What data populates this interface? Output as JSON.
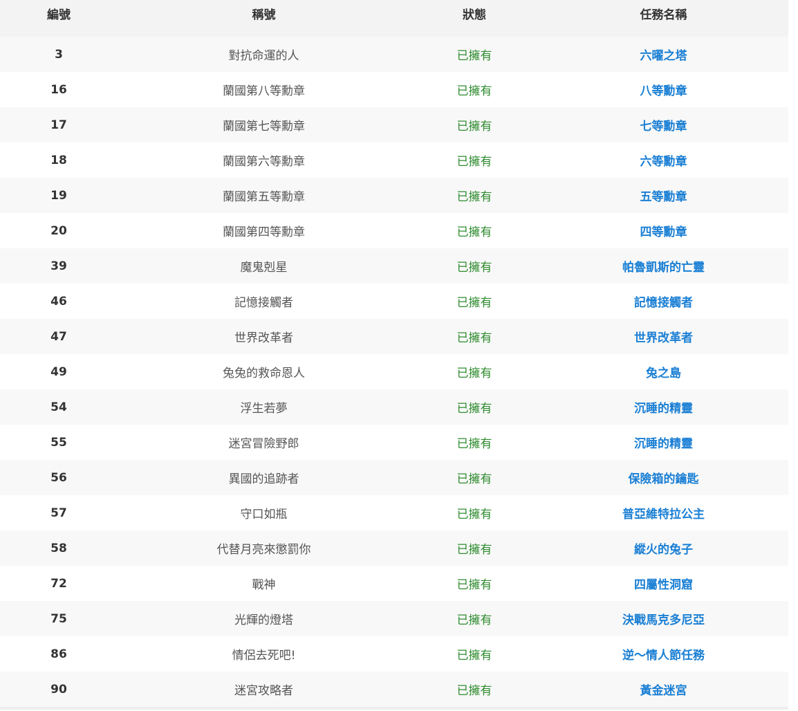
{
  "table": {
    "headers": {
      "id": "編號",
      "title": "稱號",
      "status": "狀態",
      "task": "任務名稱"
    },
    "rows": [
      {
        "id": "3",
        "title": "對抗命運的人",
        "status": "已擁有",
        "task": "六曜之塔"
      },
      {
        "id": "16",
        "title": "蘭國第八等勳章",
        "status": "已擁有",
        "task": "八等勳章"
      },
      {
        "id": "17",
        "title": "蘭國第七等勳章",
        "status": "已擁有",
        "task": "七等勳章"
      },
      {
        "id": "18",
        "title": "蘭國第六等勳章",
        "status": "已擁有",
        "task": "六等勳章"
      },
      {
        "id": "19",
        "title": "蘭國第五等勳章",
        "status": "已擁有",
        "task": "五等勳章"
      },
      {
        "id": "20",
        "title": "蘭國第四等勳章",
        "status": "已擁有",
        "task": "四等勳章"
      },
      {
        "id": "39",
        "title": "魔鬼剋星",
        "status": "已擁有",
        "task": "帕魯凱斯的亡靈"
      },
      {
        "id": "46",
        "title": "記憶接觸者",
        "status": "已擁有",
        "task": "記憶接觸者"
      },
      {
        "id": "47",
        "title": "世界改革者",
        "status": "已擁有",
        "task": "世界改革者"
      },
      {
        "id": "49",
        "title": "兔兔的救命恩人",
        "status": "已擁有",
        "task": "兔之島"
      },
      {
        "id": "54",
        "title": "浮生若夢",
        "status": "已擁有",
        "task": "沉睡的精靈"
      },
      {
        "id": "55",
        "title": "迷宮冒險野郎",
        "status": "已擁有",
        "task": "沉睡的精靈"
      },
      {
        "id": "56",
        "title": "異國的追跡者",
        "status": "已擁有",
        "task": "保險箱的鑰匙"
      },
      {
        "id": "57",
        "title": "守口如瓶",
        "status": "已擁有",
        "task": "普亞維特拉公主"
      },
      {
        "id": "58",
        "title": "代替月亮來懲罰你",
        "status": "已擁有",
        "task": "縱火的兔子"
      },
      {
        "id": "72",
        "title": "戰神",
        "status": "已擁有",
        "task": "四屬性洞窟"
      },
      {
        "id": "75",
        "title": "光輝的燈塔",
        "status": "已擁有",
        "task": "決戰馬克多尼亞"
      },
      {
        "id": "86",
        "title": "情侶去死吧!",
        "status": "已擁有",
        "task": "逆～情人節任務"
      },
      {
        "id": "90",
        "title": "迷宮攻略者",
        "status": "已擁有",
        "task": "黃金迷宮"
      }
    ]
  },
  "colors": {
    "status_owned": "#2e8b2e",
    "task_link": "#1a7fd4",
    "header_bg": "#f3f3f3",
    "row_alt_bg": "#f8f8f8"
  }
}
